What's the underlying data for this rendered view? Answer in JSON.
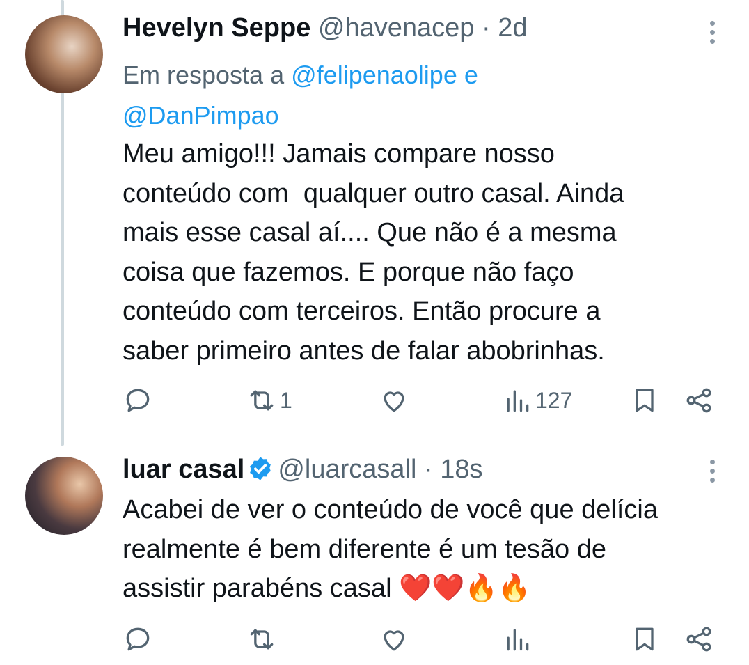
{
  "tweet1": {
    "name": "Hevelyn Seppe",
    "handle": "@havenacep",
    "separator": "·",
    "time": "2d",
    "reply_prefix": "Em resposta a",
    "reply_mention1": "@felipenaolipe",
    "reply_conj": "e",
    "reply_mention2": "@DanPimpao",
    "text": "Meu amigo!!! Jamais compare nosso\nconteúdo com  qualquer outro casal. Ainda\nmais esse casal aí.... Que não é a mesma\ncoisa que fazemos. E porque não faço\nconteúdo com terceiros. Então procure a\nsaber primeiro antes de falar abobrinhas.",
    "retweets": "1",
    "views": "127"
  },
  "tweet2": {
    "name": "luar casal",
    "handle": "@luarcasall",
    "separator": "·",
    "time": "18s",
    "text": "Acabei de ver o conteúdo de você que delícia\nrealmente é bem diferente é um tesão de\nassistir parabéns casal ❤️❤️🔥🔥"
  },
  "colors": {
    "accent": "#1d9bf0",
    "muted": "#536471",
    "thread_line": "#cfd9de"
  },
  "icons": [
    "reply-icon",
    "retweet-icon",
    "like-icon",
    "views-icon",
    "bookmark-icon",
    "share-icon",
    "more-icon",
    "verified-icon"
  ]
}
